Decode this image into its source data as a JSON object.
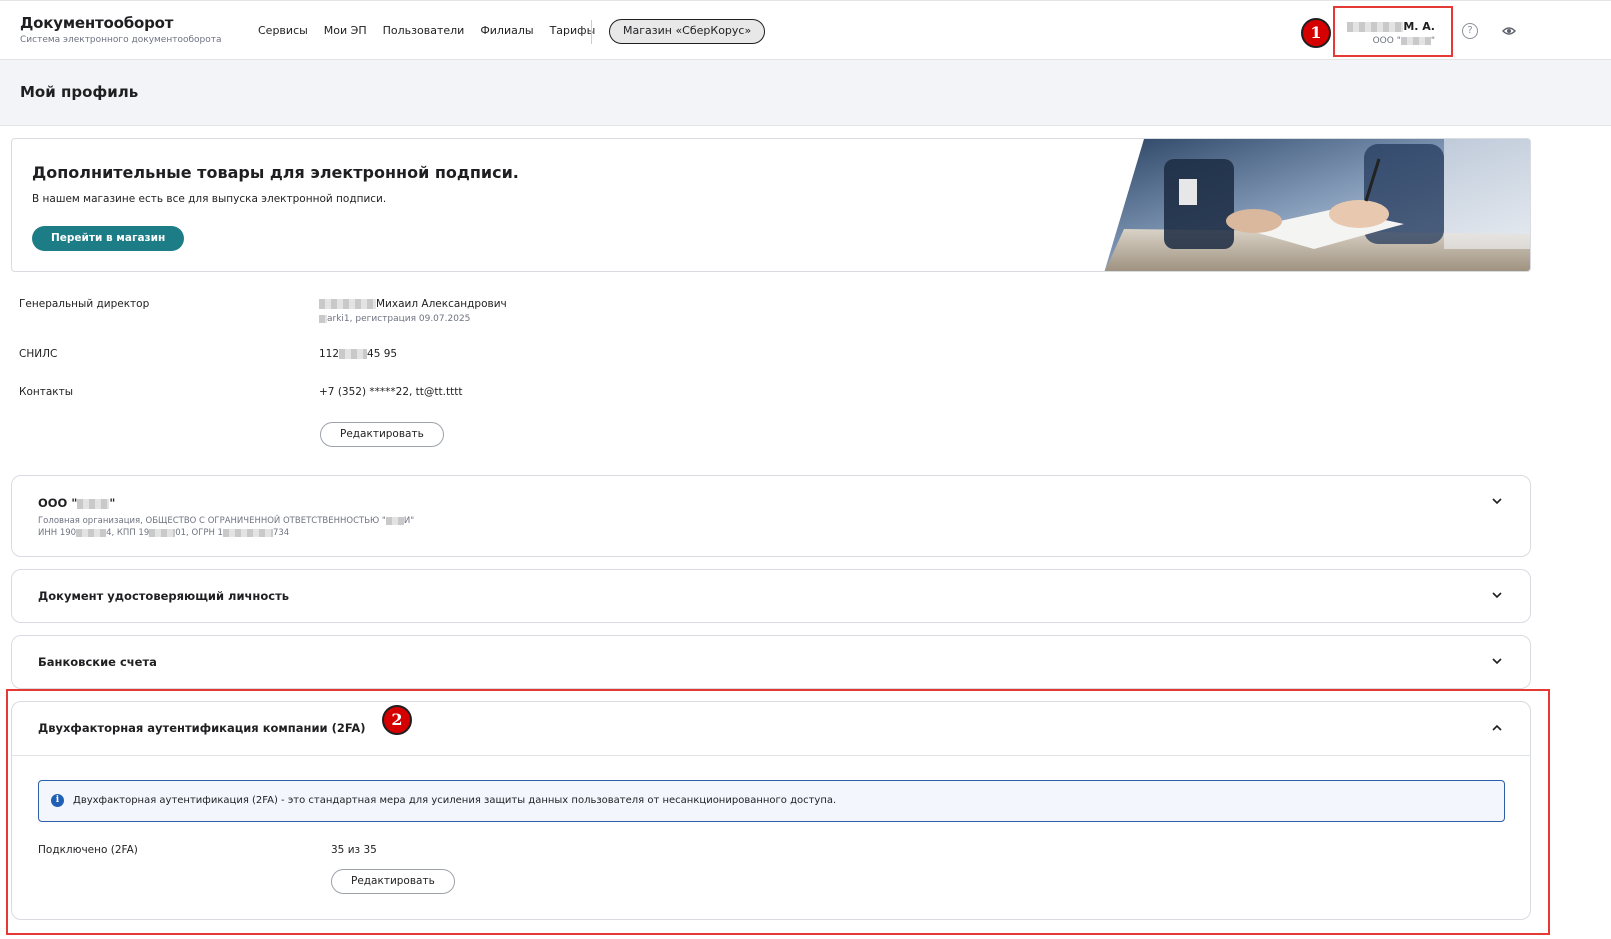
{
  "header": {
    "brand_title": "Документооборот",
    "brand_subtitle": "Система электронного документооборота",
    "nav": [
      "Сервисы",
      "Мои ЭП",
      "Пользователи",
      "Филиалы",
      "Тарифы"
    ],
    "store_button": "Магазин «СберКорус»",
    "user_name_suffix": "М. А.",
    "user_org_prefix": "ООО \"",
    "user_org_suffix": "\"",
    "help_icon_glyph": "?",
    "badge_1": "1",
    "badge_2": "2"
  },
  "page_title": "Мой профиль",
  "promo": {
    "title": "Дополнительные товары для электронной подписи.",
    "text": "В нашем магазине есть все для выпуска электронной подписи.",
    "button": "Перейти в магазин"
  },
  "profile": {
    "position_label": "Генеральный директор",
    "name_suffix": "Михаил Александрович",
    "login_suffix": "arki1, регистрация 09.07.2025",
    "snils_label": "СНИЛС",
    "snils_prefix": "112",
    "snils_suffix": "45 95",
    "contacts_label": "Контакты",
    "contacts_value": "+7 (352) *****22, tt@tt.tttt",
    "edit_button": "Редактировать"
  },
  "org_card": {
    "title_prefix": "ООО \"",
    "title_suffix": "\"",
    "sub_line1_prefix": "Головная организация, ОБЩЕСТВО С ОГРАНИЧЕННОЙ ОТВЕТСТВЕННОСТЬЮ \"",
    "sub_line1_mid": "И",
    "sub_line1_suffix": "\"",
    "inn_prefix": "ИНН 190",
    "inn_suffix": "4, КПП 19",
    "kpp_suffix": "01, ОГРН 1",
    "ogrn_suffix": "734"
  },
  "cards": {
    "identity_doc": "Документ удостоверяющий личность",
    "bank_accounts": "Банковские счета",
    "tfa_title": "Двухфакторная аутентификация компании (2FA)"
  },
  "tfa": {
    "info_icon_glyph": "i",
    "info_text": "Двухфакторная аутентификация (2FA) - это стандартная мера для усиления защиты данных пользователя от несанкционированного доступа.",
    "connected_label": "Подключено (2FA)",
    "connected_value": "35 из 35",
    "edit_button": "Редактировать"
  },
  "colors": {
    "accent": "#1d7d86",
    "annotation_red": "#e53935",
    "info_blue": "#2d5fa8"
  }
}
